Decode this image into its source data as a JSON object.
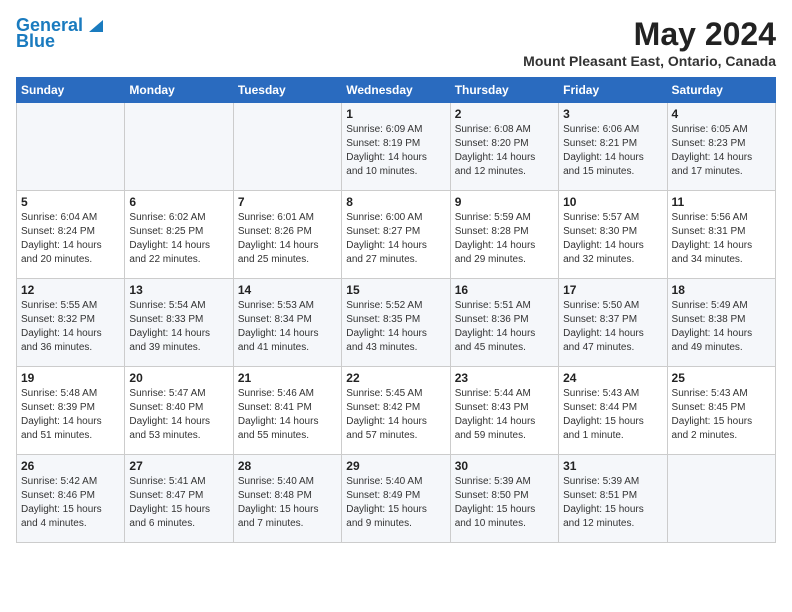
{
  "header": {
    "logo_line1": "General",
    "logo_line2": "Blue",
    "month": "May 2024",
    "location": "Mount Pleasant East, Ontario, Canada"
  },
  "days_of_week": [
    "Sunday",
    "Monday",
    "Tuesday",
    "Wednesday",
    "Thursday",
    "Friday",
    "Saturday"
  ],
  "weeks": [
    [
      {
        "day": "",
        "info": ""
      },
      {
        "day": "",
        "info": ""
      },
      {
        "day": "",
        "info": ""
      },
      {
        "day": "1",
        "info": "Sunrise: 6:09 AM\nSunset: 8:19 PM\nDaylight: 14 hours\nand 10 minutes."
      },
      {
        "day": "2",
        "info": "Sunrise: 6:08 AM\nSunset: 8:20 PM\nDaylight: 14 hours\nand 12 minutes."
      },
      {
        "day": "3",
        "info": "Sunrise: 6:06 AM\nSunset: 8:21 PM\nDaylight: 14 hours\nand 15 minutes."
      },
      {
        "day": "4",
        "info": "Sunrise: 6:05 AM\nSunset: 8:23 PM\nDaylight: 14 hours\nand 17 minutes."
      }
    ],
    [
      {
        "day": "5",
        "info": "Sunrise: 6:04 AM\nSunset: 8:24 PM\nDaylight: 14 hours\nand 20 minutes."
      },
      {
        "day": "6",
        "info": "Sunrise: 6:02 AM\nSunset: 8:25 PM\nDaylight: 14 hours\nand 22 minutes."
      },
      {
        "day": "7",
        "info": "Sunrise: 6:01 AM\nSunset: 8:26 PM\nDaylight: 14 hours\nand 25 minutes."
      },
      {
        "day": "8",
        "info": "Sunrise: 6:00 AM\nSunset: 8:27 PM\nDaylight: 14 hours\nand 27 minutes."
      },
      {
        "day": "9",
        "info": "Sunrise: 5:59 AM\nSunset: 8:28 PM\nDaylight: 14 hours\nand 29 minutes."
      },
      {
        "day": "10",
        "info": "Sunrise: 5:57 AM\nSunset: 8:30 PM\nDaylight: 14 hours\nand 32 minutes."
      },
      {
        "day": "11",
        "info": "Sunrise: 5:56 AM\nSunset: 8:31 PM\nDaylight: 14 hours\nand 34 minutes."
      }
    ],
    [
      {
        "day": "12",
        "info": "Sunrise: 5:55 AM\nSunset: 8:32 PM\nDaylight: 14 hours\nand 36 minutes."
      },
      {
        "day": "13",
        "info": "Sunrise: 5:54 AM\nSunset: 8:33 PM\nDaylight: 14 hours\nand 39 minutes."
      },
      {
        "day": "14",
        "info": "Sunrise: 5:53 AM\nSunset: 8:34 PM\nDaylight: 14 hours\nand 41 minutes."
      },
      {
        "day": "15",
        "info": "Sunrise: 5:52 AM\nSunset: 8:35 PM\nDaylight: 14 hours\nand 43 minutes."
      },
      {
        "day": "16",
        "info": "Sunrise: 5:51 AM\nSunset: 8:36 PM\nDaylight: 14 hours\nand 45 minutes."
      },
      {
        "day": "17",
        "info": "Sunrise: 5:50 AM\nSunset: 8:37 PM\nDaylight: 14 hours\nand 47 minutes."
      },
      {
        "day": "18",
        "info": "Sunrise: 5:49 AM\nSunset: 8:38 PM\nDaylight: 14 hours\nand 49 minutes."
      }
    ],
    [
      {
        "day": "19",
        "info": "Sunrise: 5:48 AM\nSunset: 8:39 PM\nDaylight: 14 hours\nand 51 minutes."
      },
      {
        "day": "20",
        "info": "Sunrise: 5:47 AM\nSunset: 8:40 PM\nDaylight: 14 hours\nand 53 minutes."
      },
      {
        "day": "21",
        "info": "Sunrise: 5:46 AM\nSunset: 8:41 PM\nDaylight: 14 hours\nand 55 minutes."
      },
      {
        "day": "22",
        "info": "Sunrise: 5:45 AM\nSunset: 8:42 PM\nDaylight: 14 hours\nand 57 minutes."
      },
      {
        "day": "23",
        "info": "Sunrise: 5:44 AM\nSunset: 8:43 PM\nDaylight: 14 hours\nand 59 minutes."
      },
      {
        "day": "24",
        "info": "Sunrise: 5:43 AM\nSunset: 8:44 PM\nDaylight: 15 hours\nand 1 minute."
      },
      {
        "day": "25",
        "info": "Sunrise: 5:43 AM\nSunset: 8:45 PM\nDaylight: 15 hours\nand 2 minutes."
      }
    ],
    [
      {
        "day": "26",
        "info": "Sunrise: 5:42 AM\nSunset: 8:46 PM\nDaylight: 15 hours\nand 4 minutes."
      },
      {
        "day": "27",
        "info": "Sunrise: 5:41 AM\nSunset: 8:47 PM\nDaylight: 15 hours\nand 6 minutes."
      },
      {
        "day": "28",
        "info": "Sunrise: 5:40 AM\nSunset: 8:48 PM\nDaylight: 15 hours\nand 7 minutes."
      },
      {
        "day": "29",
        "info": "Sunrise: 5:40 AM\nSunset: 8:49 PM\nDaylight: 15 hours\nand 9 minutes."
      },
      {
        "day": "30",
        "info": "Sunrise: 5:39 AM\nSunset: 8:50 PM\nDaylight: 15 hours\nand 10 minutes."
      },
      {
        "day": "31",
        "info": "Sunrise: 5:39 AM\nSunset: 8:51 PM\nDaylight: 15 hours\nand 12 minutes."
      },
      {
        "day": "",
        "info": ""
      }
    ]
  ]
}
